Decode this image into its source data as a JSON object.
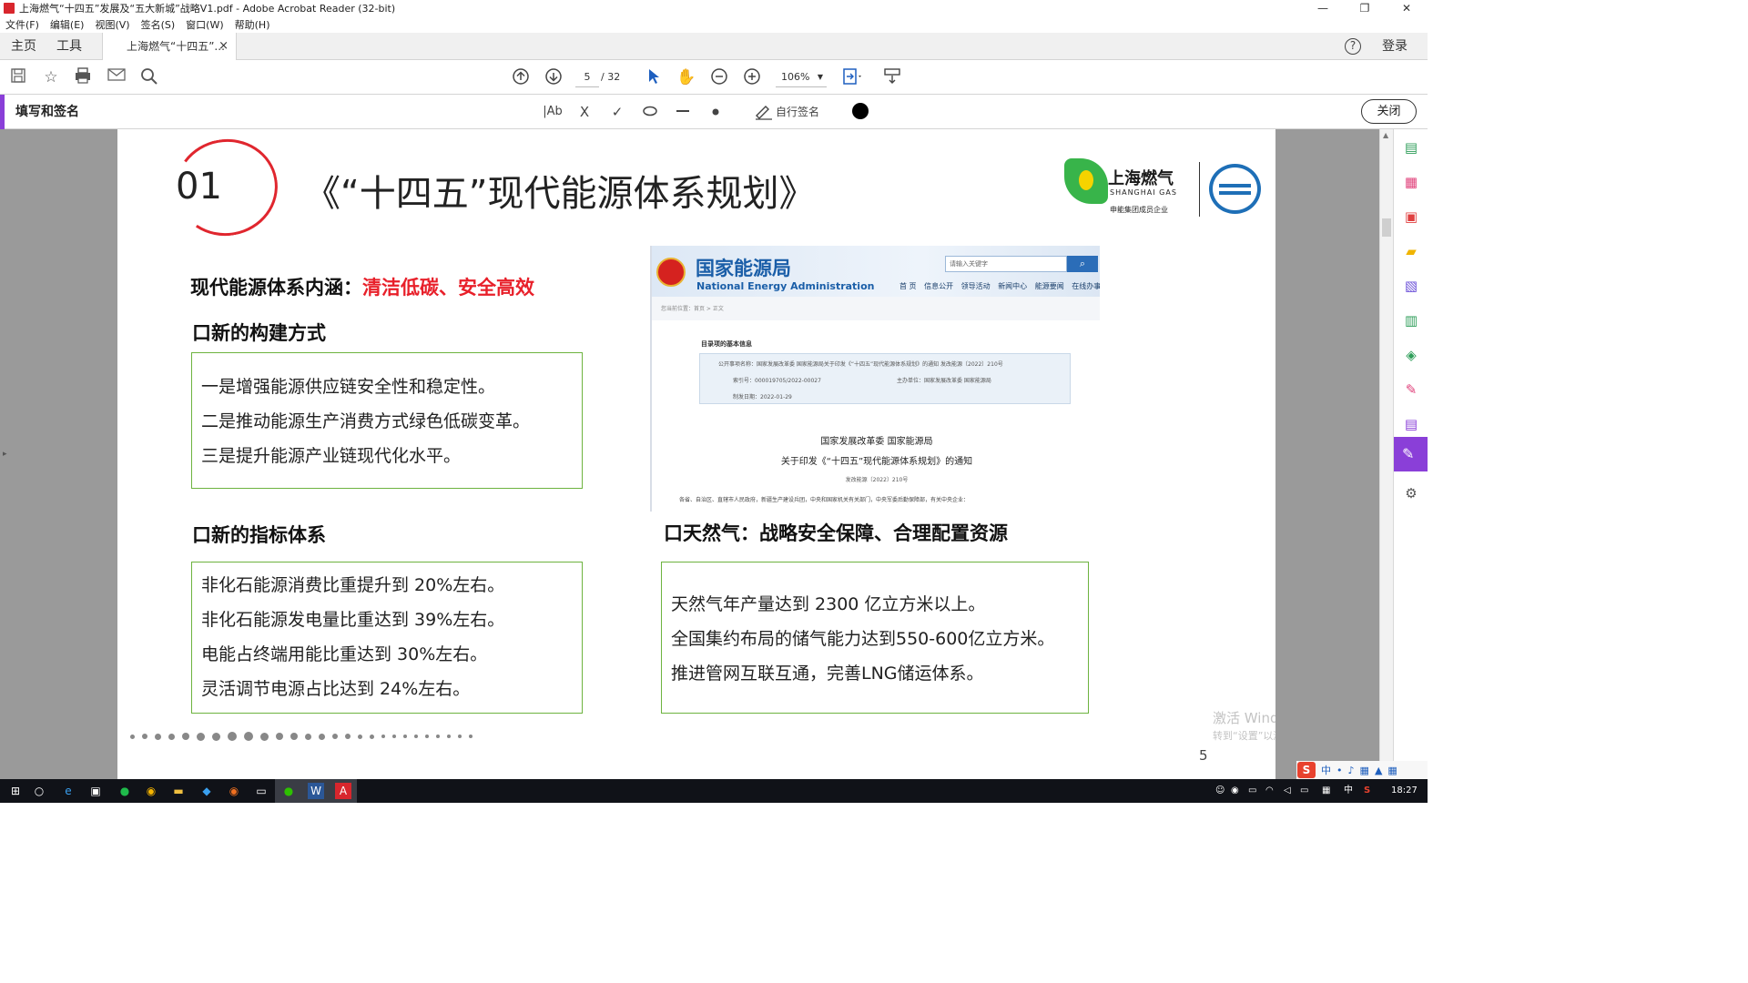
{
  "window": {
    "title": "上海燃气“十四五”发展及“五大新城”战略V1.pdf - Adobe Acrobat Reader (32-bit)",
    "controls": [
      "—",
      "❐",
      "✕"
    ]
  },
  "menu": [
    "文件(F)",
    "编辑(E)",
    "视图(V)",
    "签名(S)",
    "窗口(W)",
    "帮助(H)"
  ],
  "tabs": {
    "home": "主页",
    "tools": "工具",
    "document": "上海燃气“十四五”...",
    "close": "×",
    "help": "?",
    "login": "登录"
  },
  "toolbar": {
    "page_current": "5",
    "page_total": "/ 32",
    "zoom": "106%"
  },
  "fill_sign": {
    "title": "填写和签名",
    "text_tool": "|Ab",
    "cross": "X",
    "check": "✓",
    "self_sign": "自行签名",
    "ink_color": "#000000",
    "close": "关闭"
  },
  "slide": {
    "section_number": "01",
    "title": "《“十四五”现代能源体系规划》",
    "connotation_label": "现代能源体系内涵：",
    "connotation_value": "清洁低碳、安全高效",
    "build_heading": "口新的构建方式",
    "build_items": [
      "一是增强能源供应链安全性和稳定性。",
      "二是推动能源生产消费方式绿色低碳变革。",
      "三是提升能源产业链现代化水平。"
    ],
    "index_heading": "口新的指标体系",
    "index_items": [
      "非化石能源消费比重提升到 20%左右。",
      "非化石能源发电量比重达到 39%左右。",
      "电能占终端用能比重达到 30%左右。",
      "灵活调节电源占比达到 24%左右。"
    ],
    "gas_heading": "口天然气：战略安全保障、合理配置资源",
    "gas_items": [
      "天然气年产量达到 2300 亿立方米以上。",
      "全国集约布局的储气能力达到550-600亿立方米。",
      "推进管网互联互通，完善LNG储运体系。"
    ],
    "logo": {
      "cn": "上海燃气",
      "en": "SHANGHAI GAS",
      "sub": "申能集团成员企业"
    },
    "page_number": "5"
  },
  "nea": {
    "name_cn": "国家能源局",
    "name_en": "National Energy Administration",
    "search_placeholder": "请输入关键字",
    "nav": [
      "首 页",
      "信息公开",
      "领导活动",
      "新闻中心",
      "能源要闻",
      "在线办事"
    ],
    "breadcrumb": "您当前位置：首页 > 正文",
    "info_title": "目录项的基本信息",
    "info_name": "公开事项名称：国家发展改革委 国家能源局关于印发《“十四五”现代能源体系规划》的通知 发改能源〔2022〕210号",
    "info_index": "索引号：000019705/2022-00027",
    "info_org": "主办单位：国家发展改革委 国家能源局",
    "info_date": "制发日期：2022-01-29",
    "doc_issuer": "国家发展改革委 国家能源局",
    "doc_title": "关于印发《“十四五”现代能源体系规划》的通知",
    "doc_number": "发改能源〔2022〕210号",
    "doc_recipients": "各省、自治区、直辖市人民政府，新疆生产建设兵团，中央和国家机关有关部门，中央军委后勤保障部，有关中央企业："
  },
  "watermark": {
    "line1": "激活 Windows",
    "line2": "转到“设置”以激活 Windows。"
  },
  "ime": {
    "logo": "S",
    "mode": "中"
  },
  "taskbar": {
    "lang": "中",
    "ime_mode": "S",
    "time": "18:27"
  }
}
